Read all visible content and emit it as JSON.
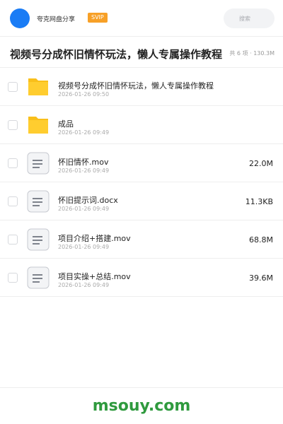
{
  "header": {
    "username": "夸克网盘分享",
    "badge": "SVIP",
    "search_placeholder": "搜索",
    "colors": {
      "avatar": "#1a7cf5",
      "badge": "#f7a027"
    }
  },
  "folder": {
    "title": "视频号分成怀旧情怀玩法，懒人专属操作教程",
    "summary": "共 6 项 · 130.3M"
  },
  "files": [
    {
      "type": "folder",
      "icon": "folder-icon",
      "name": "视频号分成怀旧情怀玩法，懒人专属操作教程",
      "date": "2026-01-26 09:50",
      "size": ""
    },
    {
      "type": "folder",
      "icon": "folder-icon",
      "name": "成品",
      "date": "2026-01-26 09:49",
      "size": ""
    },
    {
      "type": "file",
      "icon": "document-icon",
      "name": "怀旧情怀.mov",
      "date": "2026-01-26 09:49",
      "size": "22.0M"
    },
    {
      "type": "file",
      "icon": "document-icon",
      "name": "怀旧提示词.docx",
      "date": "2026-01-26 09:49",
      "size": "11.3KB"
    },
    {
      "type": "file",
      "icon": "document-icon",
      "name": "项目介绍+搭建.mov",
      "date": "2026-01-26 09:49",
      "size": "68.8M"
    },
    {
      "type": "file",
      "icon": "document-icon",
      "name": "项目实操+总结.mov",
      "date": "2026-01-26 09:49",
      "size": "39.6M"
    }
  ],
  "watermark": "msouy.com"
}
